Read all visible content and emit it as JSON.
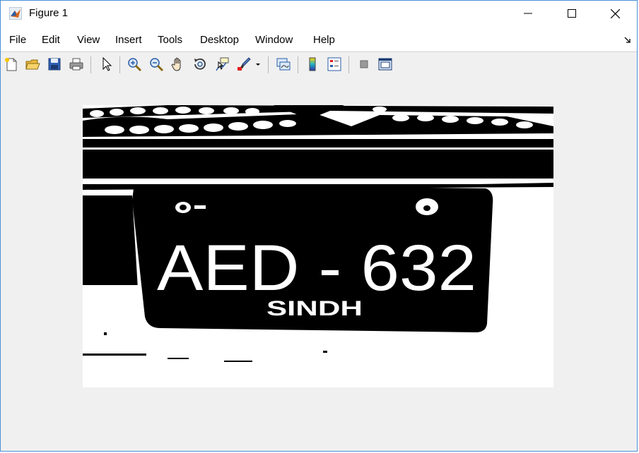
{
  "window": {
    "title": "Figure 1",
    "controls": {
      "minimize": "minimize",
      "maximize": "maximize",
      "close": "close"
    }
  },
  "menu": {
    "items": [
      "File",
      "Edit",
      "View",
      "Insert",
      "Tools",
      "Desktop",
      "Window",
      "Help"
    ]
  },
  "toolbar": {
    "icons": [
      "new-figure-icon",
      "open-file-icon",
      "save-icon",
      "print-icon",
      "select-arrow-icon",
      "zoom-in-icon",
      "zoom-out-icon",
      "pan-hand-icon",
      "rotate-3d-icon",
      "data-cursor-icon",
      "brush-icon",
      "brush-dropdown-icon",
      "link-plot-icon",
      "colorbar-icon",
      "legend-icon",
      "hide-plot-tools-icon",
      "show-plot-tools-icon"
    ]
  },
  "image": {
    "plate_main": "AED - 632",
    "plate_sub": "SINDH"
  },
  "colors": {
    "window_bg": "#f0f0f0",
    "border": "#4a90d9"
  }
}
